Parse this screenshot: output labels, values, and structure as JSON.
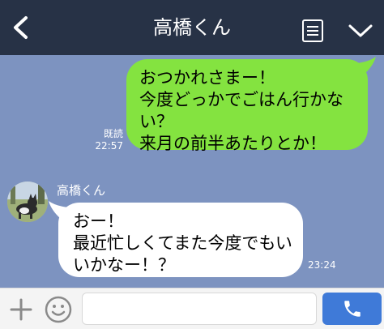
{
  "header": {
    "back_icon": "chevron-left-icon",
    "title": "高橋くん",
    "memo_icon": "note-icon",
    "menu_icon": "chevron-down-icon"
  },
  "messages": {
    "outgoing": {
      "text": "おつかれさまー！\n今度どっかでごはん行かない？\n来月の前半あたりとか！",
      "read_label": "既読",
      "time": "22:57"
    },
    "incoming": {
      "sender": "高橋くん",
      "avatar": "dog-photo-avatar",
      "text": "おー！\n最近忙しくてまた今度でもいいかなー！？",
      "time": "23:24"
    }
  },
  "input_bar": {
    "add_icon": "plus-icon",
    "emoji_icon": "smiley-icon",
    "input_value": "",
    "call_icon": "phone-icon"
  },
  "colors": {
    "background": "#7d93c0",
    "header": "#273246",
    "outgoing_bubble": "#84e340",
    "incoming_bubble": "#ffffff",
    "call_button": "#3f7ad8"
  }
}
